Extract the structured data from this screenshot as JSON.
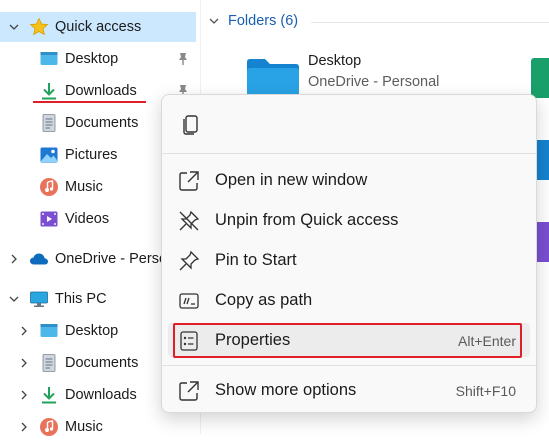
{
  "nav": {
    "quick_access": "Quick access",
    "qa_items": [
      {
        "label": "Desktop"
      },
      {
        "label": "Downloads"
      },
      {
        "label": "Documents"
      },
      {
        "label": "Pictures"
      },
      {
        "label": "Music"
      },
      {
        "label": "Videos"
      }
    ],
    "onedrive": "OneDrive - Perso",
    "this_pc": "This PC",
    "pc_items": [
      {
        "label": "Desktop"
      },
      {
        "label": "Documents"
      },
      {
        "label": "Downloads"
      },
      {
        "label": "Music"
      }
    ]
  },
  "content": {
    "group_header": "Folders (6)",
    "tile": {
      "name": "Desktop",
      "subtitle": "OneDrive - Personal"
    }
  },
  "menu": {
    "items": [
      {
        "label": "Open in new window",
        "shortcut": ""
      },
      {
        "label": "Unpin from Quick access",
        "shortcut": ""
      },
      {
        "label": "Pin to Start",
        "shortcut": ""
      },
      {
        "label": "Copy as path",
        "shortcut": ""
      },
      {
        "label": "Properties",
        "shortcut": "Alt+Enter"
      },
      {
        "label": "Show more options",
        "shortcut": "Shift+F10"
      }
    ]
  },
  "colors": {
    "selection": "#cce8ff",
    "highlight_red": "#e01e2a",
    "accent_blue": "#1a5fb4",
    "folder_blue": "#1e90d6"
  }
}
